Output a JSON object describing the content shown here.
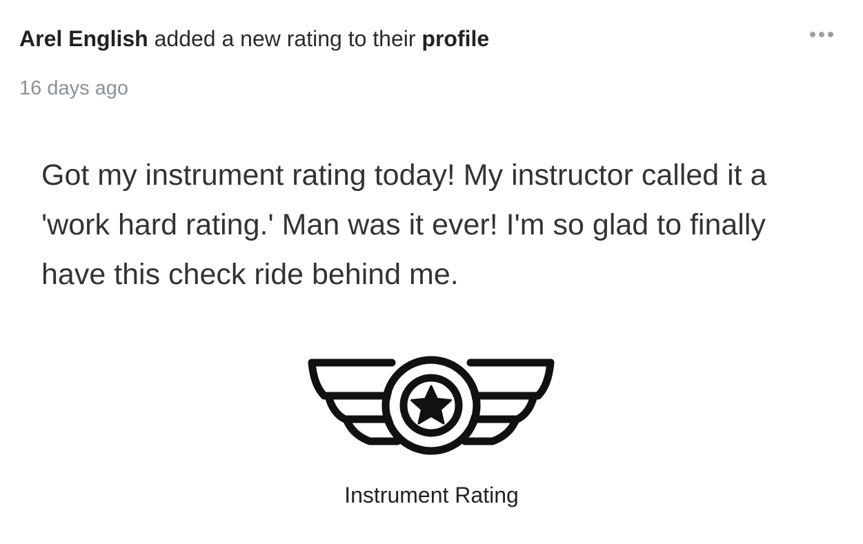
{
  "post": {
    "author": "Arel English",
    "action_text": "added a new rating to their",
    "profile_link": "profile",
    "timestamp": "16 days ago",
    "body": "Got my instrument rating today! My instructor called it a 'work hard rating.' Man was it ever! I'm so glad to finally have this check ride behind me.",
    "more_icon": "more-horizontal-icon",
    "badge": {
      "icon": "winged-star-badge-icon",
      "label": "Instrument Rating"
    }
  },
  "colors": {
    "text": "#2b2b2b",
    "muted": "#8a909a",
    "icon": "#111111"
  }
}
